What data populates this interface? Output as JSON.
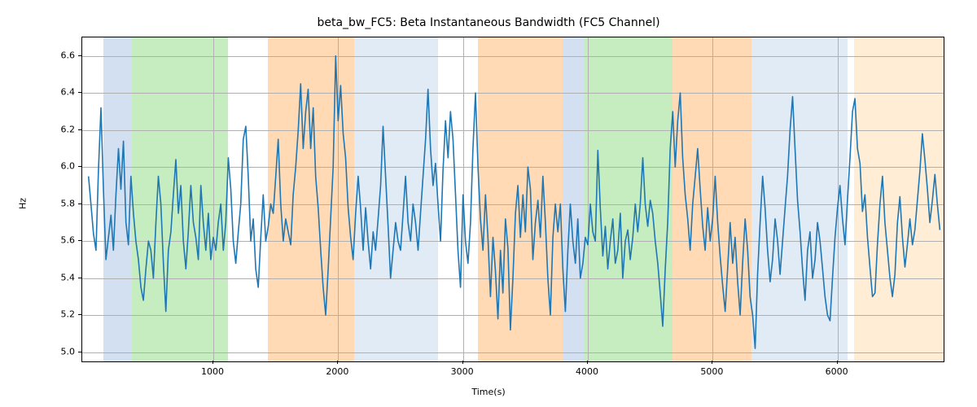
{
  "chart_data": {
    "type": "line",
    "title": "beta_bw_FC5: Beta Instantaneous Bandwidth (FC5 Channel)",
    "xlabel": "Time(s)",
    "ylabel": "Hz",
    "xlim": [
      -50,
      6850
    ],
    "ylim": [
      4.95,
      6.7
    ],
    "x_ticks": [
      1000,
      2000,
      3000,
      4000,
      5000,
      6000
    ],
    "y_ticks": [
      5.0,
      5.2,
      5.4,
      5.6,
      5.8,
      6.0,
      6.2,
      6.4,
      6.6
    ],
    "regions": [
      {
        "start": 120,
        "end": 350,
        "color": "#aec7e8",
        "alpha": 0.55
      },
      {
        "start": 350,
        "end": 1120,
        "color": "#98df8a",
        "alpha": 0.55
      },
      {
        "start": 1440,
        "end": 2130,
        "color": "#ffbb78",
        "alpha": 0.55
      },
      {
        "start": 2130,
        "end": 2800,
        "color": "#c6dbef",
        "alpha": 0.55
      },
      {
        "start": 3120,
        "end": 3800,
        "color": "#ffbb78",
        "alpha": 0.55
      },
      {
        "start": 3800,
        "end": 3970,
        "color": "#aec7e8",
        "alpha": 0.55
      },
      {
        "start": 3970,
        "end": 4680,
        "color": "#98df8a",
        "alpha": 0.55
      },
      {
        "start": 4680,
        "end": 5310,
        "color": "#ffbb78",
        "alpha": 0.55
      },
      {
        "start": 5310,
        "end": 6080,
        "color": "#c6dbef",
        "alpha": 0.55
      },
      {
        "start": 6130,
        "end": 6850,
        "color": "#ffe0b2",
        "alpha": 0.55
      }
    ],
    "series": [
      {
        "name": "beta_bw_FC5",
        "color": "#1f77b4",
        "x_step": 20,
        "x_start": 0,
        "values": [
          5.95,
          5.8,
          5.64,
          5.55,
          5.98,
          6.32,
          5.87,
          5.5,
          5.62,
          5.74,
          5.55,
          5.85,
          6.1,
          5.88,
          6.14,
          5.7,
          5.58,
          5.95,
          5.75,
          5.6,
          5.5,
          5.35,
          5.28,
          5.45,
          5.6,
          5.55,
          5.4,
          5.7,
          5.95,
          5.8,
          5.48,
          5.22,
          5.55,
          5.65,
          5.85,
          6.04,
          5.75,
          5.9,
          5.6,
          5.45,
          5.65,
          5.9,
          5.7,
          5.62,
          5.5,
          5.9,
          5.7,
          5.55,
          5.75,
          5.5,
          5.62,
          5.55,
          5.7,
          5.8,
          5.55,
          5.7,
          6.05,
          5.88,
          5.6,
          5.48,
          5.65,
          5.8,
          6.15,
          6.22,
          5.95,
          5.6,
          5.72,
          5.45,
          5.35,
          5.62,
          5.85,
          5.6,
          5.68,
          5.8,
          5.75,
          5.95,
          6.15,
          5.8,
          5.6,
          5.72,
          5.65,
          5.58,
          5.85,
          6.0,
          6.2,
          6.45,
          6.1,
          6.3,
          6.42,
          6.1,
          6.32,
          5.95,
          5.78,
          5.55,
          5.35,
          5.2,
          5.45,
          5.72,
          6.0,
          6.6,
          6.25,
          6.44,
          6.18,
          6.05,
          5.78,
          5.62,
          5.5,
          5.75,
          5.95,
          5.78,
          5.55,
          5.78,
          5.6,
          5.45,
          5.65,
          5.55,
          5.72,
          5.9,
          6.22,
          5.95,
          5.68,
          5.4,
          5.55,
          5.7,
          5.6,
          5.55,
          5.75,
          5.95,
          5.7,
          5.6,
          5.8,
          5.7,
          5.55,
          5.75,
          5.95,
          6.15,
          6.42,
          6.1,
          5.9,
          6.02,
          5.8,
          5.6,
          5.98,
          6.25,
          6.05,
          6.3,
          6.15,
          5.85,
          5.55,
          5.35,
          5.85,
          5.6,
          5.48,
          5.7,
          6.1,
          6.4,
          6.0,
          5.72,
          5.55,
          5.85,
          5.62,
          5.3,
          5.62,
          5.44,
          5.18,
          5.55,
          5.32,
          5.72,
          5.56,
          5.12,
          5.4,
          5.75,
          5.9,
          5.62,
          5.85,
          5.65,
          6.0,
          5.88,
          5.5,
          5.7,
          5.82,
          5.62,
          5.95,
          5.7,
          5.4,
          5.2,
          5.62,
          5.8,
          5.65,
          5.8,
          5.45,
          5.22,
          5.55,
          5.8,
          5.6,
          5.48,
          5.72,
          5.4,
          5.48,
          5.62,
          5.58,
          5.8,
          5.65,
          5.6,
          6.09,
          5.78,
          5.52,
          5.68,
          5.45,
          5.6,
          5.72,
          5.48,
          5.55,
          5.75,
          5.4,
          5.6,
          5.66,
          5.5,
          5.62,
          5.8,
          5.65,
          5.8,
          6.05,
          5.8,
          5.68,
          5.82,
          5.75,
          5.6,
          5.48,
          5.32,
          5.14,
          5.45,
          5.7,
          6.1,
          6.3,
          6.0,
          6.25,
          6.4,
          6.05,
          5.85,
          5.72,
          5.55,
          5.8,
          5.95,
          6.1,
          5.88,
          5.68,
          5.55,
          5.78,
          5.6,
          5.72,
          5.95,
          5.7,
          5.52,
          5.36,
          5.22,
          5.45,
          5.7,
          5.48,
          5.62,
          5.38,
          5.2,
          5.48,
          5.72,
          5.55,
          5.3,
          5.2,
          5.02,
          5.42,
          5.7,
          5.95,
          5.78,
          5.55,
          5.38,
          5.5,
          5.72,
          5.6,
          5.42,
          5.6,
          5.78,
          5.95,
          6.2,
          6.38,
          6.1,
          5.82,
          5.65,
          5.45,
          5.28,
          5.55,
          5.65,
          5.4,
          5.5,
          5.7,
          5.6,
          5.45,
          5.3,
          5.2,
          5.17,
          5.4,
          5.62,
          5.78,
          5.9,
          5.72,
          5.58,
          5.82,
          6.05,
          6.3,
          6.37,
          6.1,
          6.02,
          5.76,
          5.85,
          5.62,
          5.46,
          5.3,
          5.32,
          5.58,
          5.8,
          5.95,
          5.7,
          5.55,
          5.4,
          5.3,
          5.42,
          5.7,
          5.84,
          5.62,
          5.46,
          5.58,
          5.72,
          5.58,
          5.66,
          5.82,
          5.98,
          6.18,
          6.04,
          5.88,
          5.7,
          5.82,
          5.96,
          5.8,
          5.66
        ]
      }
    ]
  }
}
